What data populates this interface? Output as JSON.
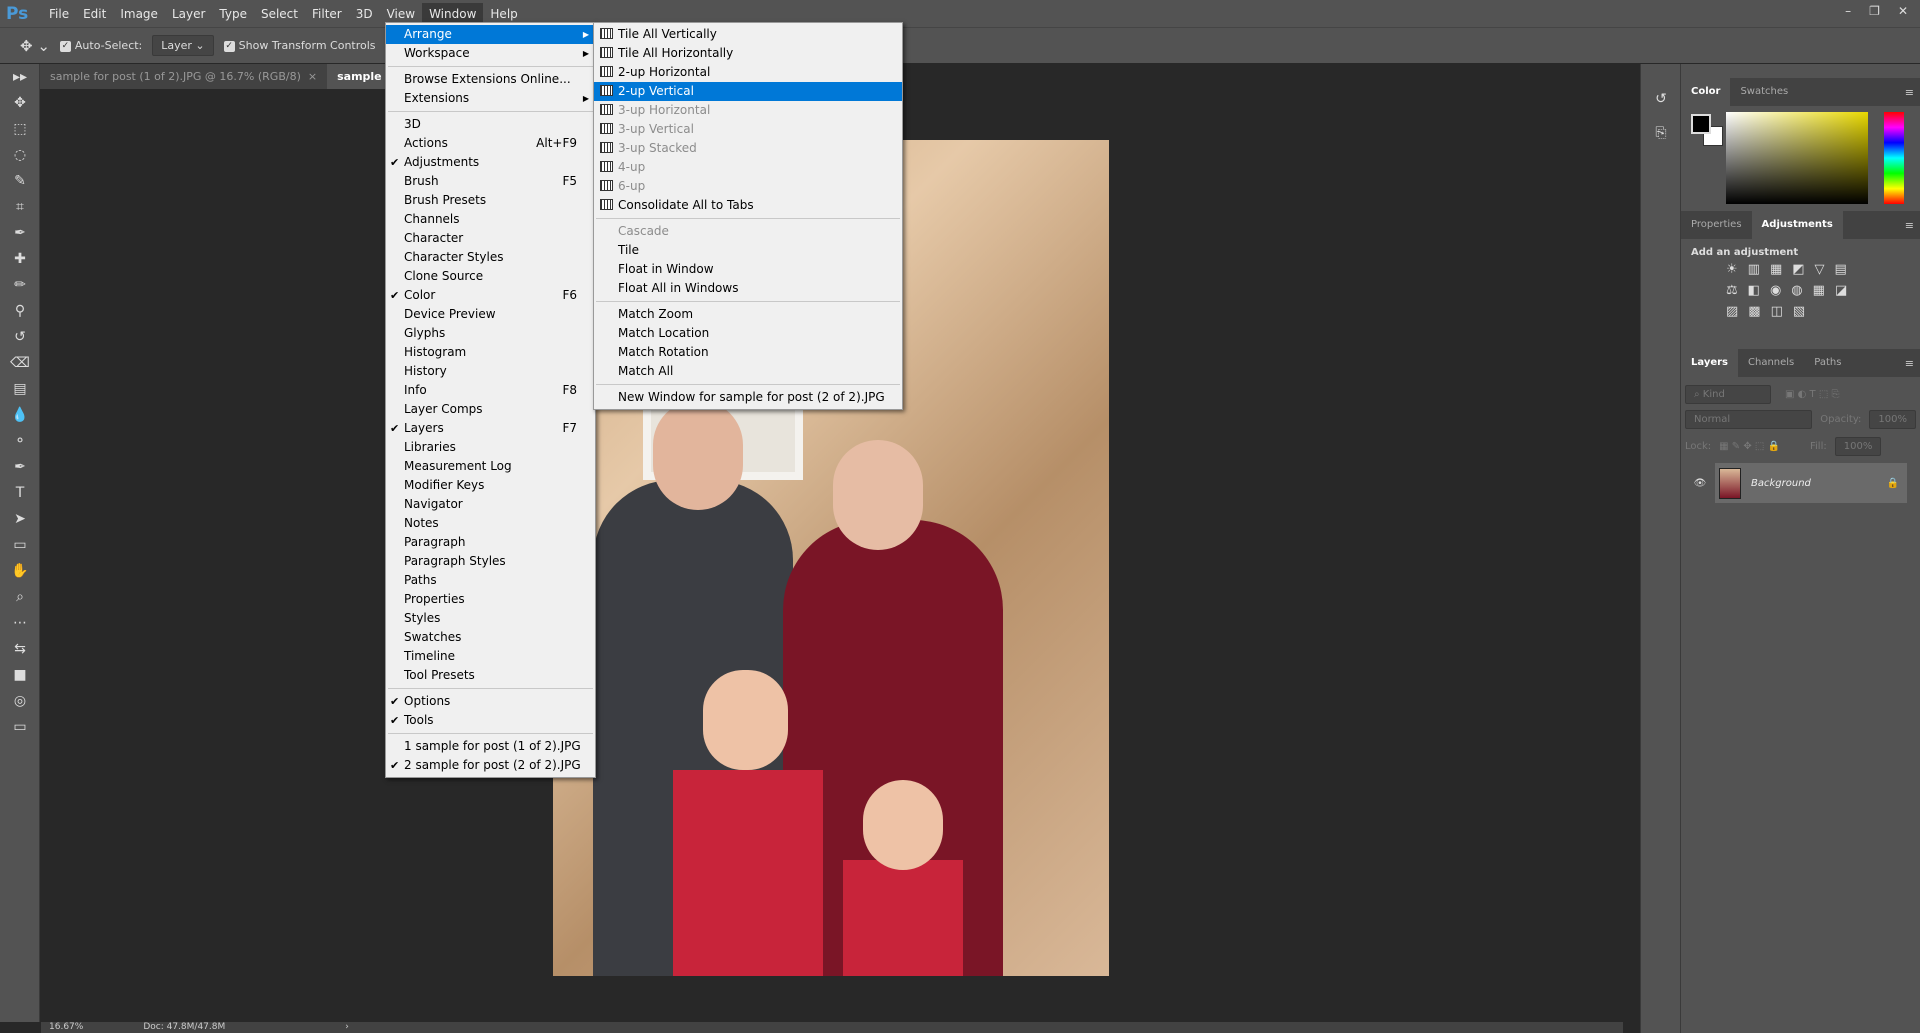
{
  "app": {
    "logo": "Ps",
    "menus": [
      "File",
      "Edit",
      "Image",
      "Layer",
      "Type",
      "Select",
      "Filter",
      "3D",
      "View",
      "Window",
      "Help"
    ],
    "active_menu": "Window",
    "window_controls": [
      "–",
      "❐",
      "✕"
    ]
  },
  "options": {
    "auto_select": "Auto-Select:",
    "auto_select_checked": true,
    "target": "Layer",
    "show_transform": "Show Transform Controls",
    "show_transform_checked": true
  },
  "tabs": [
    {
      "label": "sample for post (1 of 2).JPG @ 16.7% (RGB/8)",
      "close": "×"
    },
    {
      "label": "sample for post (2 of 2).JPG",
      "active": true
    }
  ],
  "status": {
    "zoom": "16.67%",
    "doc": "Doc: 47.8M/47.8M",
    "arrow": "›"
  },
  "window_menu": [
    {
      "label": "Arrange",
      "submenu": true,
      "highlight": true
    },
    {
      "label": "Workspace",
      "submenu": true
    },
    {
      "sep": true
    },
    {
      "label": "Browse Extensions Online..."
    },
    {
      "label": "Extensions",
      "submenu": true
    },
    {
      "sep": true
    },
    {
      "label": "3D"
    },
    {
      "label": "Actions",
      "shortcut": "Alt+F9"
    },
    {
      "label": "Adjustments",
      "checked": true
    },
    {
      "label": "Brush",
      "shortcut": "F5"
    },
    {
      "label": "Brush Presets"
    },
    {
      "label": "Channels"
    },
    {
      "label": "Character"
    },
    {
      "label": "Character Styles"
    },
    {
      "label": "Clone Source"
    },
    {
      "label": "Color",
      "checked": true,
      "shortcut": "F6"
    },
    {
      "label": "Device Preview"
    },
    {
      "label": "Glyphs"
    },
    {
      "label": "Histogram"
    },
    {
      "label": "History"
    },
    {
      "label": "Info",
      "shortcut": "F8"
    },
    {
      "label": "Layer Comps"
    },
    {
      "label": "Layers",
      "checked": true,
      "shortcut": "F7"
    },
    {
      "label": "Libraries"
    },
    {
      "label": "Measurement Log"
    },
    {
      "label": "Modifier Keys"
    },
    {
      "label": "Navigator"
    },
    {
      "label": "Notes"
    },
    {
      "label": "Paragraph"
    },
    {
      "label": "Paragraph Styles"
    },
    {
      "label": "Paths"
    },
    {
      "label": "Properties"
    },
    {
      "label": "Styles"
    },
    {
      "label": "Swatches"
    },
    {
      "label": "Timeline"
    },
    {
      "label": "Tool Presets"
    },
    {
      "sep": true
    },
    {
      "label": "Options",
      "checked": true
    },
    {
      "label": "Tools",
      "checked": true
    },
    {
      "sep": true
    },
    {
      "label": "1 sample for post (1 of 2).JPG"
    },
    {
      "label": "2 sample for post (2 of 2).JPG",
      "checked": true
    }
  ],
  "arrange_menu": [
    {
      "label": "Tile All Vertically",
      "icon": "tile-vertical"
    },
    {
      "label": "Tile All Horizontally",
      "icon": "tile-horizontal"
    },
    {
      "label": "2-up Horizontal",
      "icon": "2up-horizontal"
    },
    {
      "label": "2-up Vertical",
      "icon": "2up-vertical",
      "highlight": true
    },
    {
      "label": "3-up Horizontal",
      "icon": "3up-horizontal",
      "disabled": true
    },
    {
      "label": "3-up Vertical",
      "icon": "3up-vertical",
      "disabled": true
    },
    {
      "label": "3-up Stacked",
      "icon": "3up-stacked",
      "disabled": true
    },
    {
      "label": "4-up",
      "icon": "4up",
      "disabled": true
    },
    {
      "label": "6-up",
      "icon": "6up",
      "disabled": true
    },
    {
      "label": "Consolidate All to Tabs",
      "icon": "consolidate"
    },
    {
      "sep": true
    },
    {
      "label": "Cascade",
      "disabled": true
    },
    {
      "label": "Tile"
    },
    {
      "label": "Float in Window"
    },
    {
      "label": "Float All in Windows"
    },
    {
      "sep": true
    },
    {
      "label": "Match Zoom"
    },
    {
      "label": "Match Location"
    },
    {
      "label": "Match Rotation"
    },
    {
      "label": "Match All"
    },
    {
      "sep": true
    },
    {
      "label": "New Window for sample for post (2 of 2).JPG"
    }
  ],
  "panels": {
    "color": {
      "tabs": [
        "Color",
        "Swatches"
      ],
      "foreground": "#000000",
      "background": "#ffffff",
      "hue": "#e8d800"
    },
    "adjust": {
      "tabs": [
        "Properties",
        "Adjustments"
      ],
      "title": "Add an adjustment"
    },
    "layers": {
      "tabs": [
        "Layers",
        "Channels",
        "Paths"
      ],
      "kind": "Kind",
      "blend": "Normal",
      "opacity_label": "Opacity:",
      "opacity": "100%",
      "lock_label": "Lock:",
      "fill_label": "Fill:",
      "fill": "100%",
      "layer_name": "Background"
    }
  },
  "colors": {
    "accent": "#0078d7",
    "ui": "#535353",
    "canvas": "#282828"
  }
}
